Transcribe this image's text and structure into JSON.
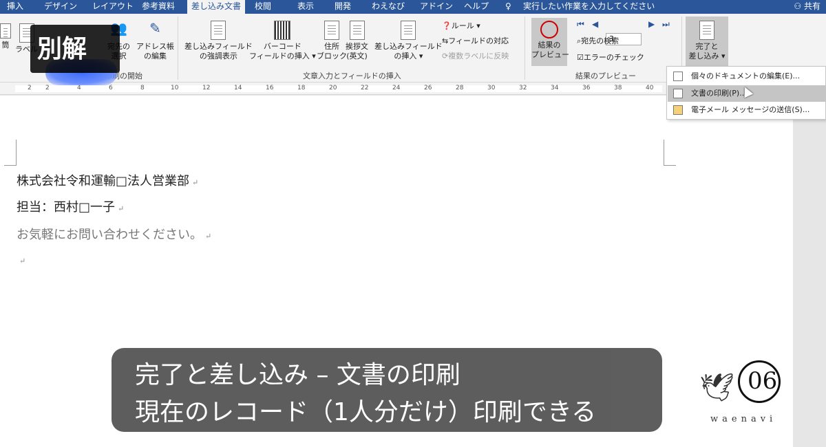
{
  "tabs": [
    {
      "label": "挿入",
      "active": false
    },
    {
      "label": "デザイン",
      "active": false
    },
    {
      "label": "レイアウト",
      "active": false
    },
    {
      "label": "参考資料",
      "active": false
    },
    {
      "label": "差し込み文書",
      "active": true
    },
    {
      "label": "校閲",
      "active": false
    },
    {
      "label": "表示",
      "active": false
    },
    {
      "label": "開発",
      "active": false
    },
    {
      "label": "わえなび",
      "active": false
    },
    {
      "label": "アドイン",
      "active": false
    },
    {
      "label": "ヘルプ",
      "active": false
    }
  ],
  "tell_me": "実行したい作業を入力してください",
  "share": "共有",
  "ribbon": {
    "start_group": {
      "label": "差し込み印刷の開始",
      "buttons": [
        "筒",
        "ラベル",
        "宛先の選択",
        "アドレス帳の編集"
      ],
      "addr_btn_line1": "アドレス帳",
      "addr_btn_line2": "の編集",
      "recipient_btn_line1": "宛先の",
      "recipient_btn_line2": "選択"
    },
    "insert_group": {
      "label": "文章入力とフィールドの挿入",
      "highlight_line1": "差し込みフィールド",
      "highlight_line2": "の強調表示",
      "barcode_line1": "バーコード",
      "barcode_line2": "フィールドの挿入 ▾",
      "address_line1": "住所",
      "address_line2": "ブロック",
      "greeting_line1": "挨拶文",
      "greeting_line2": "(英文)",
      "insert_field_line1": "差し込みフィールド",
      "insert_field_line2": "の挿入 ▾",
      "rules": "ルール ▾",
      "match_fields": "フィールドの対応",
      "update_labels": "複数ラベルに反映"
    },
    "preview_group": {
      "label": "結果のプレビュー",
      "preview_line1": "結果の",
      "preview_line2": "プレビュー",
      "record_value": "3",
      "find_recipient": "宛先の検索",
      "check_errors": "エラーのチェック"
    },
    "finish_group": {
      "finish_line1": "完了と",
      "finish_line2": "差し込み ▾"
    }
  },
  "ruler_numbers": [
    "2",
    "2",
    "4",
    "6",
    "8",
    "10",
    "12",
    "14",
    "16",
    "18",
    "20",
    "22",
    "24",
    "26",
    "28",
    "30",
    "32",
    "34",
    "36",
    "38",
    "40"
  ],
  "dropdown": {
    "items": [
      {
        "label": "個々のドキュメントの編集(E)...",
        "hover": false
      },
      {
        "label": "文書の印刷(P)...",
        "hover": true
      },
      {
        "label": "電子メール メッセージの送信(S)...",
        "hover": false
      }
    ]
  },
  "document": {
    "lines": [
      {
        "text": "株式会社令和運輸□法人営業部",
        "gray": false
      },
      {
        "text": "担当：西村□一子",
        "gray": false
      },
      {
        "text": "お気軽にお問い合わせください。",
        "gray": true
      },
      {
        "text": "",
        "gray": false
      }
    ],
    "para_mark": "↵"
  },
  "overlay": {
    "badge": "別解",
    "caption_line1": "完了と差し込み – 文書の印刷",
    "caption_line2": "現在のレコード（1人分だけ）印刷できる"
  },
  "logo": {
    "number": "06",
    "brand": "waenavi"
  }
}
